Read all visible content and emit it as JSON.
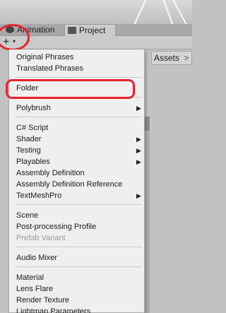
{
  "tabs": [
    {
      "label": "Animation",
      "icon": "animation-icon"
    },
    {
      "label": "Project",
      "icon": "folder-icon",
      "active": true
    }
  ],
  "toolbar": {
    "create_glyph": "+",
    "dropdown_glyph": "▾"
  },
  "breadcrumb": {
    "label": "Assets",
    "separator": ">"
  },
  "annotation_color": "#e8232b",
  "menu": {
    "items": [
      {
        "label": "Original Phrases"
      },
      {
        "label": "Translated Phrases"
      },
      {
        "label": "Folder",
        "highlighted": true
      },
      {
        "label": "Polybrush",
        "submenu": true
      },
      {
        "label": "C# Script"
      },
      {
        "label": "Shader",
        "submenu": true
      },
      {
        "label": "Testing",
        "submenu": true
      },
      {
        "label": "Playables",
        "submenu": true
      },
      {
        "label": "Assembly Definition"
      },
      {
        "label": "Assembly Definition Reference"
      },
      {
        "label": "TextMeshPro",
        "submenu": true
      },
      {
        "label": "Scene"
      },
      {
        "label": "Post-processing Profile"
      },
      {
        "label": "Prefab Variant",
        "disabled": true
      },
      {
        "label": "Audio Mixer"
      },
      {
        "label": "Material"
      },
      {
        "label": "Lens Flare"
      },
      {
        "label": "Render Texture"
      },
      {
        "label": "Lightmap Parameters"
      }
    ],
    "submenu_arrow": "▶"
  }
}
